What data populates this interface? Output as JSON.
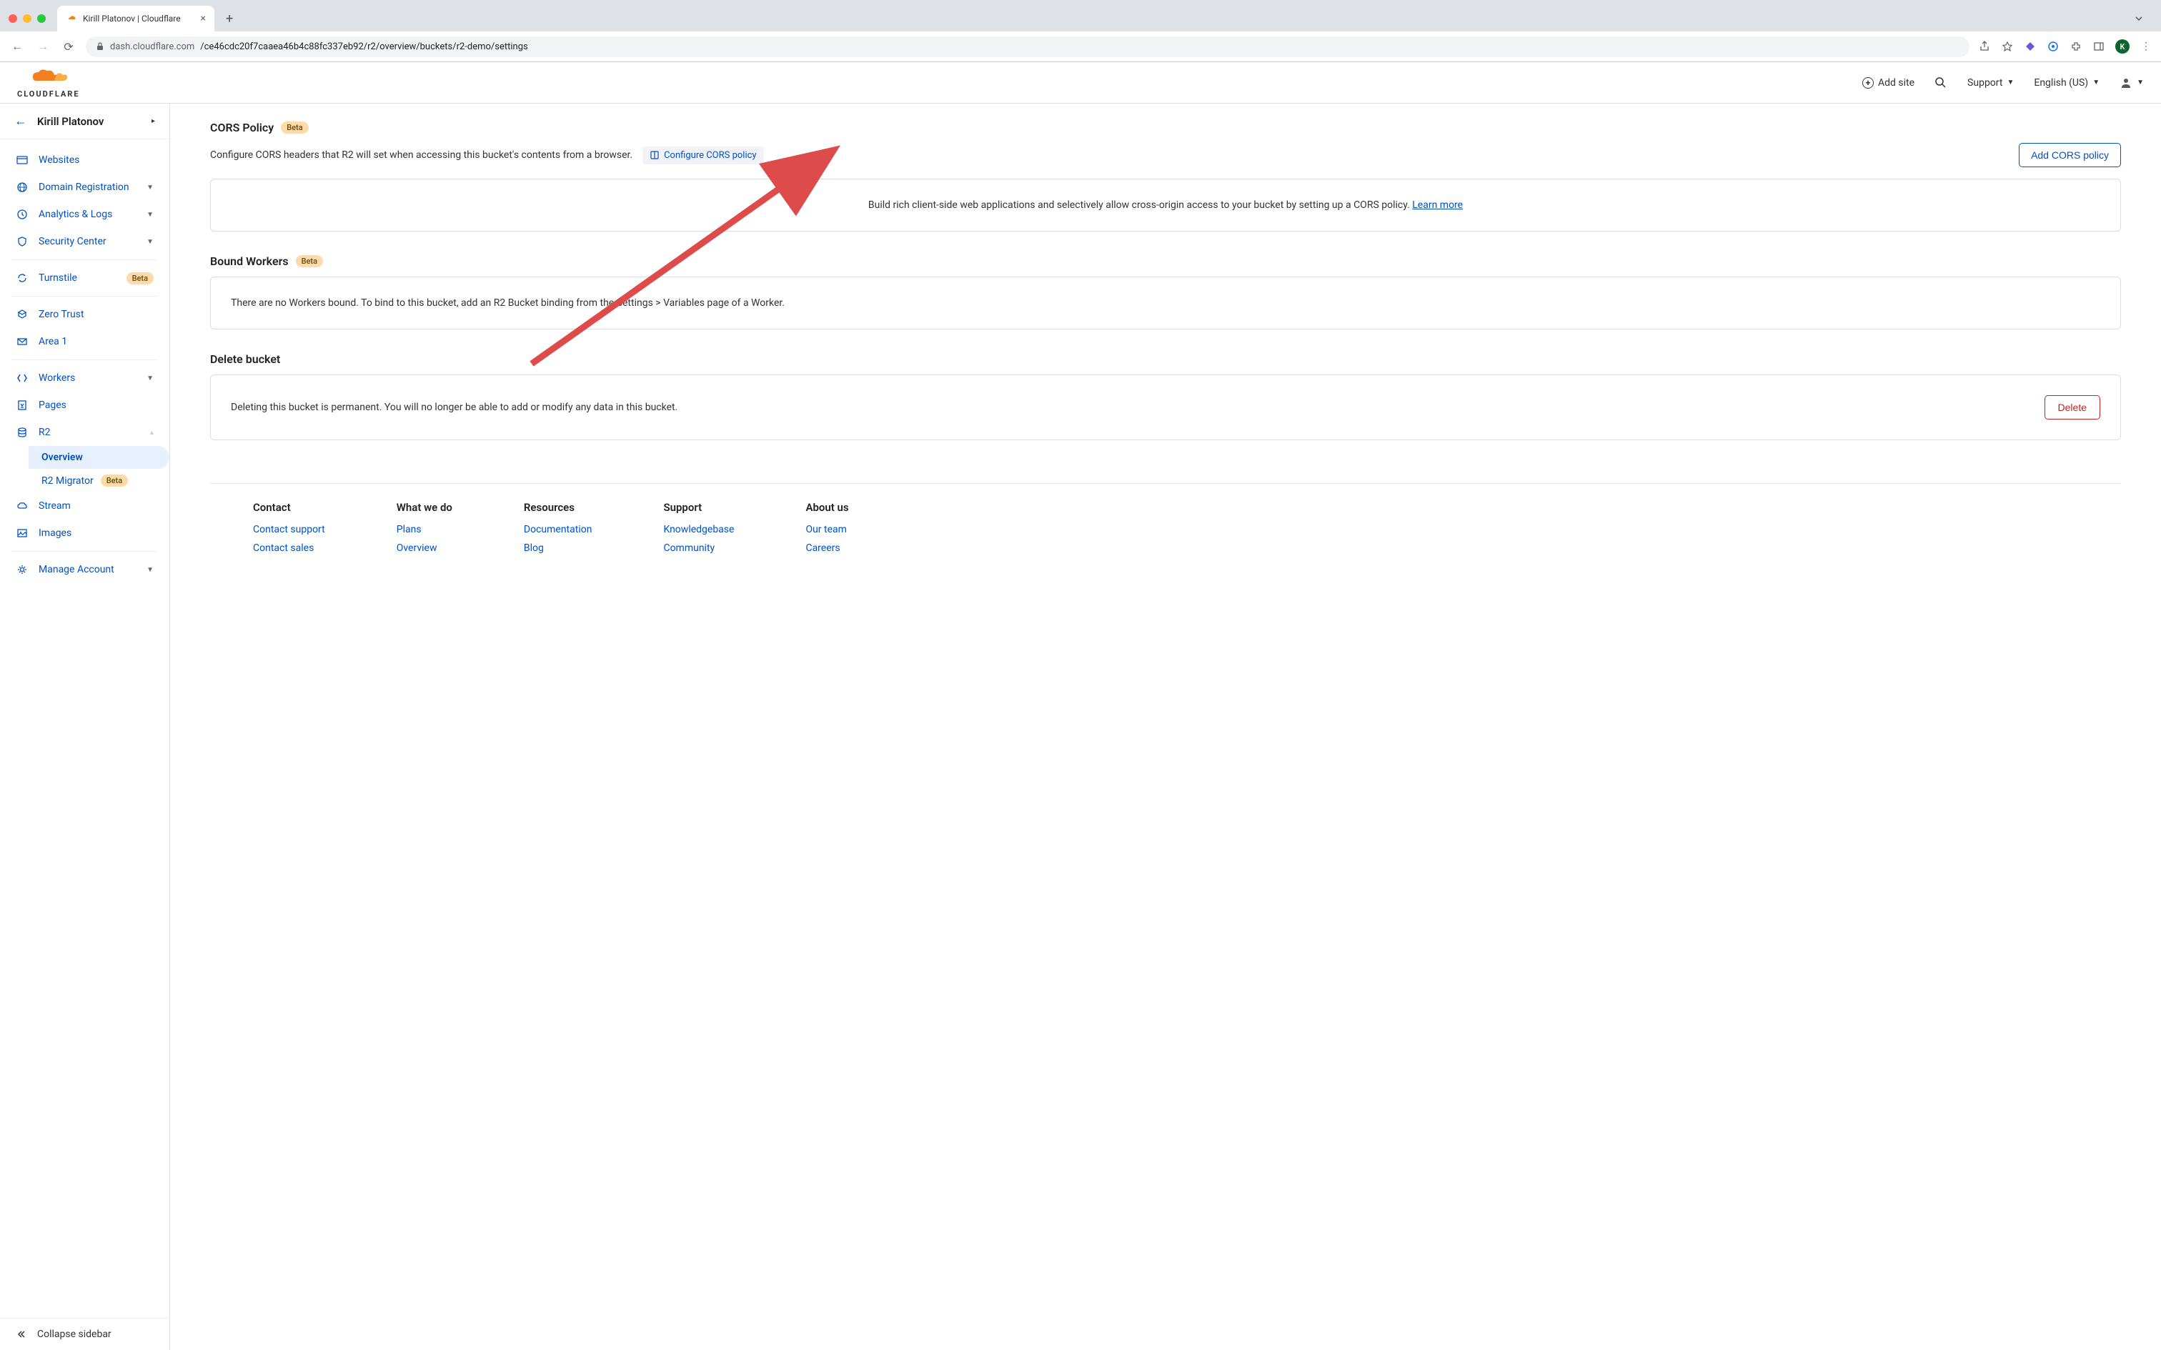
{
  "browser": {
    "tab_title": "Kirill Platonov | Cloudflare",
    "url_host": "dash.cloudflare.com",
    "url_path": "/ce46cdc20f7caaea46b4c88fc337eb92/r2/overview/buckets/r2-demo/settings",
    "avatar_letter": "K"
  },
  "header": {
    "logo_text": "CLOUDFLARE",
    "add_site": "Add site",
    "support": "Support",
    "language": "English (US)"
  },
  "sidebar": {
    "account_name": "Kirill Platonov",
    "items": [
      {
        "label": "Websites",
        "icon": "browser"
      },
      {
        "label": "Domain Registration",
        "icon": "globe",
        "chevron": true
      },
      {
        "label": "Analytics & Logs",
        "icon": "clock",
        "chevron": true
      },
      {
        "label": "Security Center",
        "icon": "shield",
        "chevron": true
      }
    ],
    "items2": [
      {
        "label": "Turnstile",
        "icon": "refresh",
        "beta": true
      }
    ],
    "items3": [
      {
        "label": "Zero Trust",
        "icon": "trust"
      },
      {
        "label": "Area 1",
        "icon": "mail"
      }
    ],
    "items4": [
      {
        "label": "Workers",
        "icon": "workers",
        "chevron": true
      },
      {
        "label": "Pages",
        "icon": "pages"
      },
      {
        "label": "R2",
        "icon": "database",
        "chevron": "up",
        "sub": [
          {
            "label": "Overview",
            "active": true
          },
          {
            "label": "R2 Migrator",
            "beta": true
          }
        ]
      },
      {
        "label": "Stream",
        "icon": "cloud"
      },
      {
        "label": "Images",
        "icon": "image"
      }
    ],
    "items5": [
      {
        "label": "Manage Account",
        "icon": "gear",
        "chevron": true
      }
    ],
    "collapse": "Collapse sidebar",
    "beta_label": "Beta"
  },
  "sections": {
    "cors": {
      "title": "CORS Policy",
      "beta": true,
      "desc": "Configure CORS headers that R2 will set when accessing this bucket's contents from a browser.",
      "configure_link": "Configure CORS policy",
      "add_button": "Add CORS policy",
      "box_text": "Build rich client-side web applications and selectively allow cross-origin access to your bucket by setting up a CORS policy. ",
      "learn_more": "Learn more"
    },
    "bound_workers": {
      "title": "Bound Workers",
      "beta": true,
      "box_text": "There are no Workers bound. To bind to this bucket, add an R2 Bucket binding from the Settings > Variables page of a Worker."
    },
    "delete": {
      "title": "Delete bucket",
      "box_text": "Deleting this bucket is permanent. You will no longer be able to add or modify any data in this bucket.",
      "button": "Delete"
    }
  },
  "footer": {
    "columns": [
      {
        "heading": "Contact",
        "links": [
          "Contact support",
          "Contact sales"
        ]
      },
      {
        "heading": "What we do",
        "links": [
          "Plans",
          "Overview"
        ]
      },
      {
        "heading": "Resources",
        "links": [
          "Documentation",
          "Blog"
        ]
      },
      {
        "heading": "Support",
        "links": [
          "Knowledgebase",
          "Community"
        ]
      },
      {
        "heading": "About us",
        "links": [
          "Our team",
          "Careers"
        ]
      }
    ]
  }
}
